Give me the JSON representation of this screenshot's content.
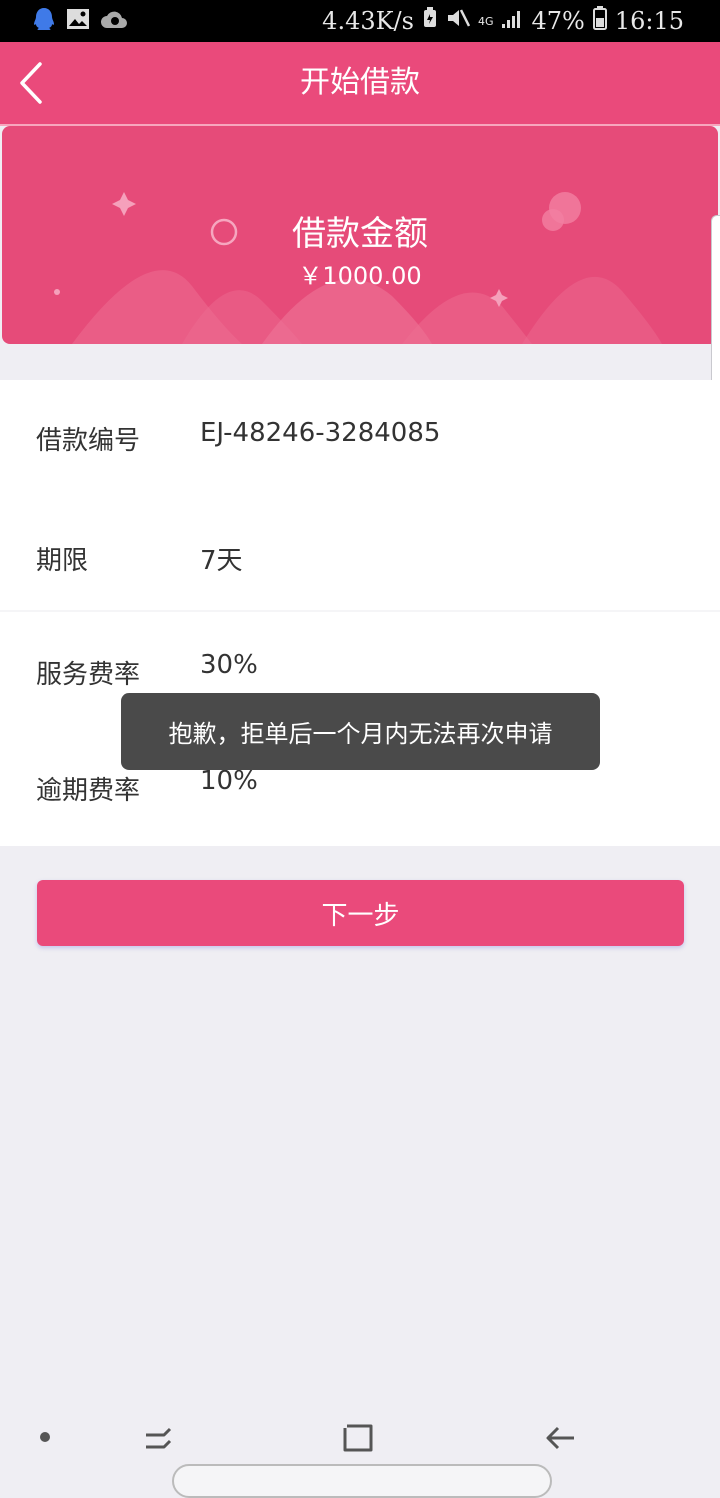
{
  "status_bar": {
    "speed": "4.43K/s",
    "network": "4G",
    "battery": "47%",
    "time": "16:15",
    "icons": [
      "qq-icon",
      "gallery-icon",
      "cloud-icon",
      "battery-saver-icon",
      "mute-icon",
      "network-4g-icon",
      "signal-icon",
      "battery-icon"
    ]
  },
  "header": {
    "title": "开始借款",
    "back_icon": "chevron-left-icon"
  },
  "banner": {
    "title": "借款金额",
    "amount": "￥1000.00"
  },
  "info": [
    {
      "label": "借款编号",
      "value": "EJ-48246-3284085"
    },
    {
      "label": "期限",
      "value": "7天"
    },
    {
      "label": "服务费率",
      "value": "30%"
    },
    {
      "label": "逾期费率",
      "value": "10%"
    }
  ],
  "toast": "抱歉，拒单后一个月内无法再次申请",
  "next_button": "下一步",
  "colors": {
    "accent": "#ea4a7b",
    "background": "#efeef3",
    "toast": "#4a4a4a"
  }
}
